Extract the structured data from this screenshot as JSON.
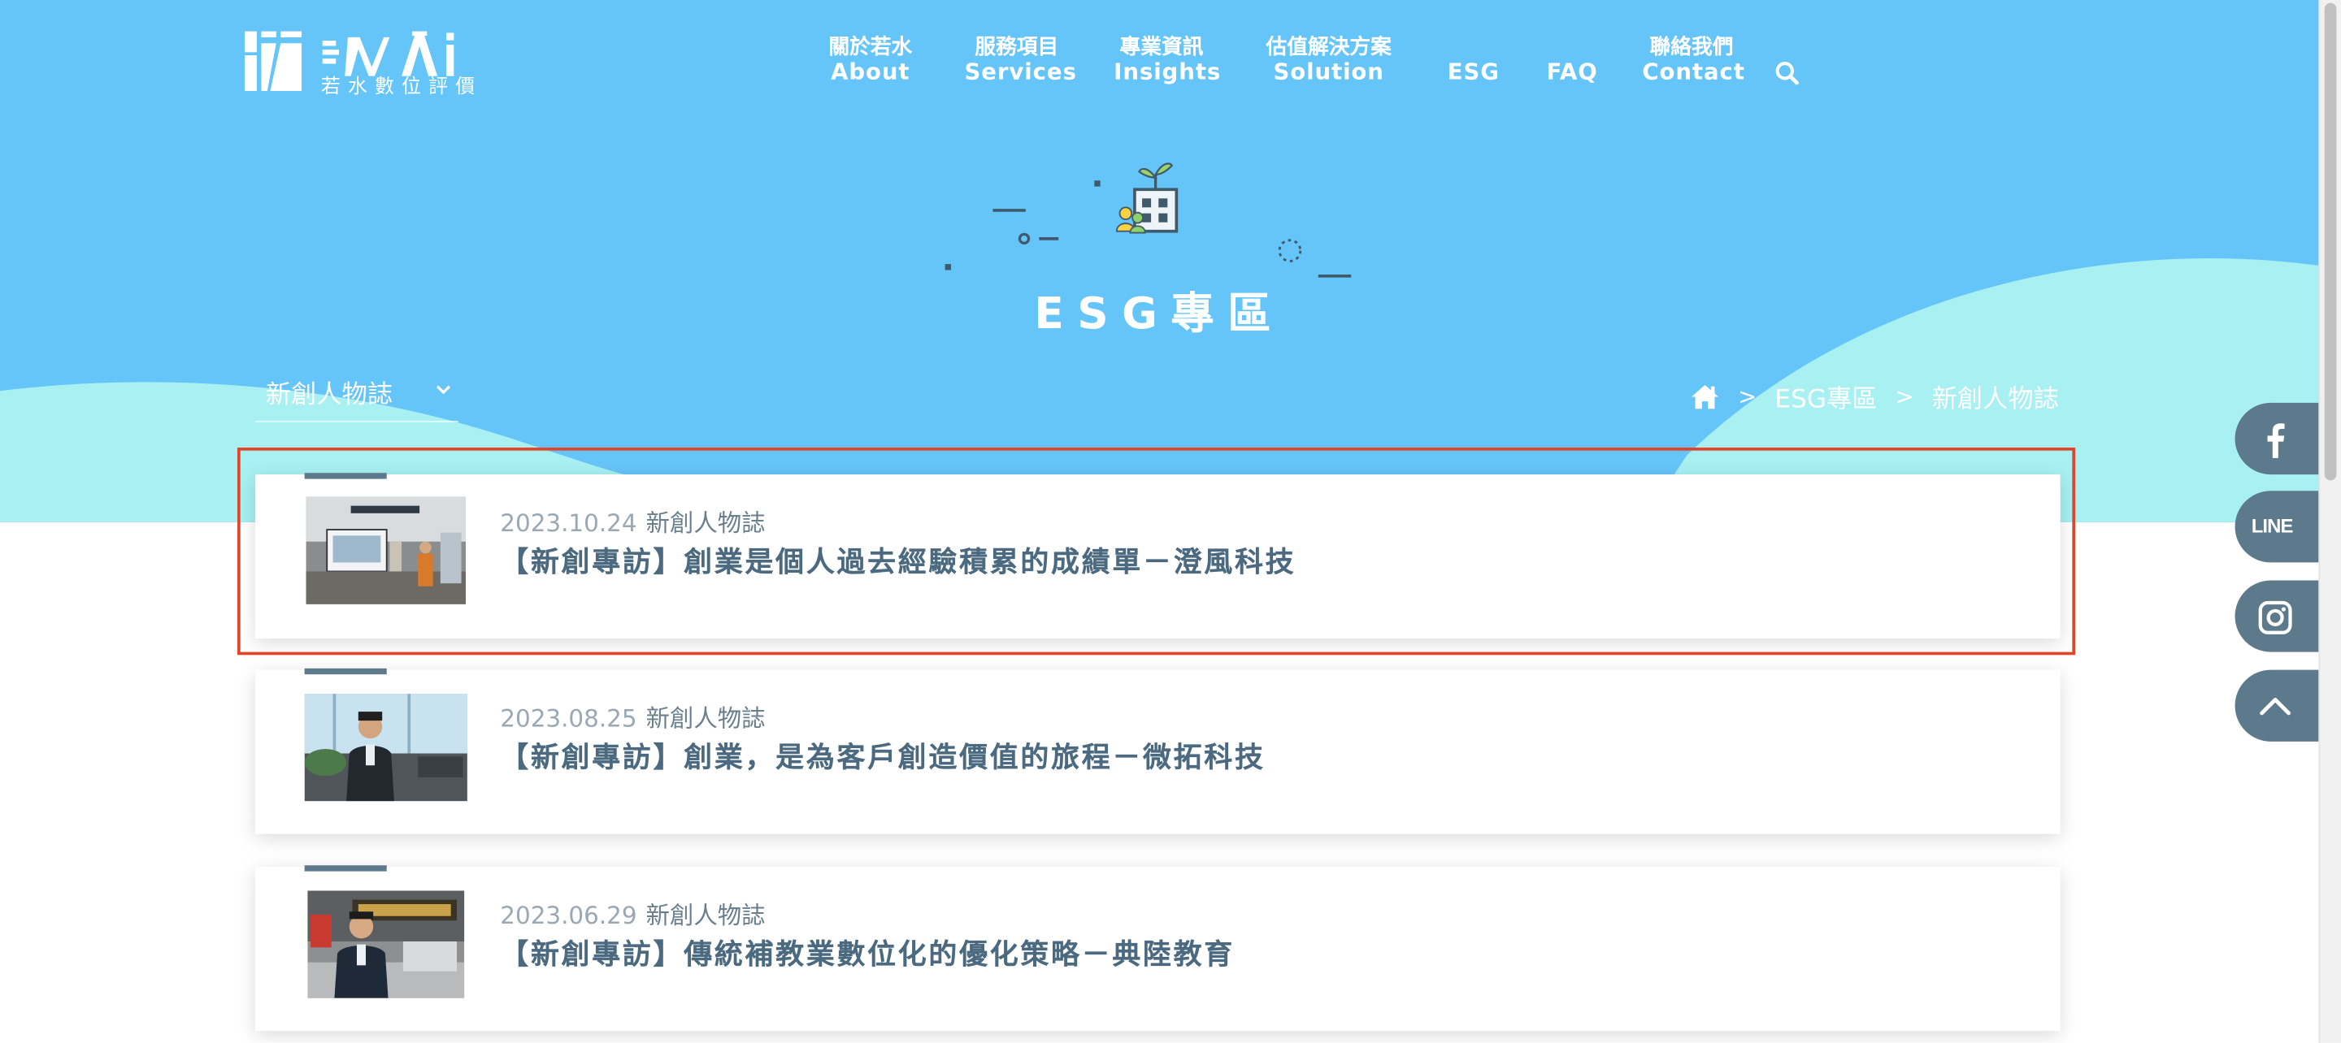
{
  "brand": {
    "logo_text": "WAi",
    "subtitle": "若水數位評價"
  },
  "nav": [
    {
      "zh": "關於若水",
      "en": "About"
    },
    {
      "zh": "服務項目",
      "en": "Services"
    },
    {
      "zh": "專業資訊",
      "en": "Insights"
    },
    {
      "zh": "估值解決方案",
      "en": "Solution"
    },
    {
      "zh": "",
      "en": "ESG"
    },
    {
      "zh": "",
      "en": "FAQ"
    },
    {
      "zh": "聯絡我們",
      "en": "Contact"
    }
  ],
  "hero": {
    "title": "ESG專區"
  },
  "category": {
    "selected": "新創人物誌"
  },
  "breadcrumb": {
    "items": [
      "ESG專區",
      "新創人物誌"
    ],
    "separator": ">"
  },
  "articles": [
    {
      "date": "2023.10.24",
      "category": "新創人物誌",
      "title": "【新創專訪】創業是個人過去經驗積累的成績單－澄風科技"
    },
    {
      "date": "2023.08.25",
      "category": "新創人物誌",
      "title": "【新創專訪】創業，是為客戶創造價值的旅程－微拓科技"
    },
    {
      "date": "2023.06.29",
      "category": "新創人物誌",
      "title": "【新創專訪】傳統補教業數位化的優化策略－典陸教育"
    }
  ],
  "social": {
    "line_label": "LINE",
    "buttons": [
      "facebook-icon",
      "line-icon",
      "instagram-icon",
      "back-to-top-icon"
    ]
  },
  "colors": {
    "hero_blue": "#66c5f8",
    "wave_cyan": "#a8f0f2",
    "accent_slate": "#5d7a8c",
    "title_text": "#4b6a80",
    "highlight_red": "#e0452b"
  }
}
